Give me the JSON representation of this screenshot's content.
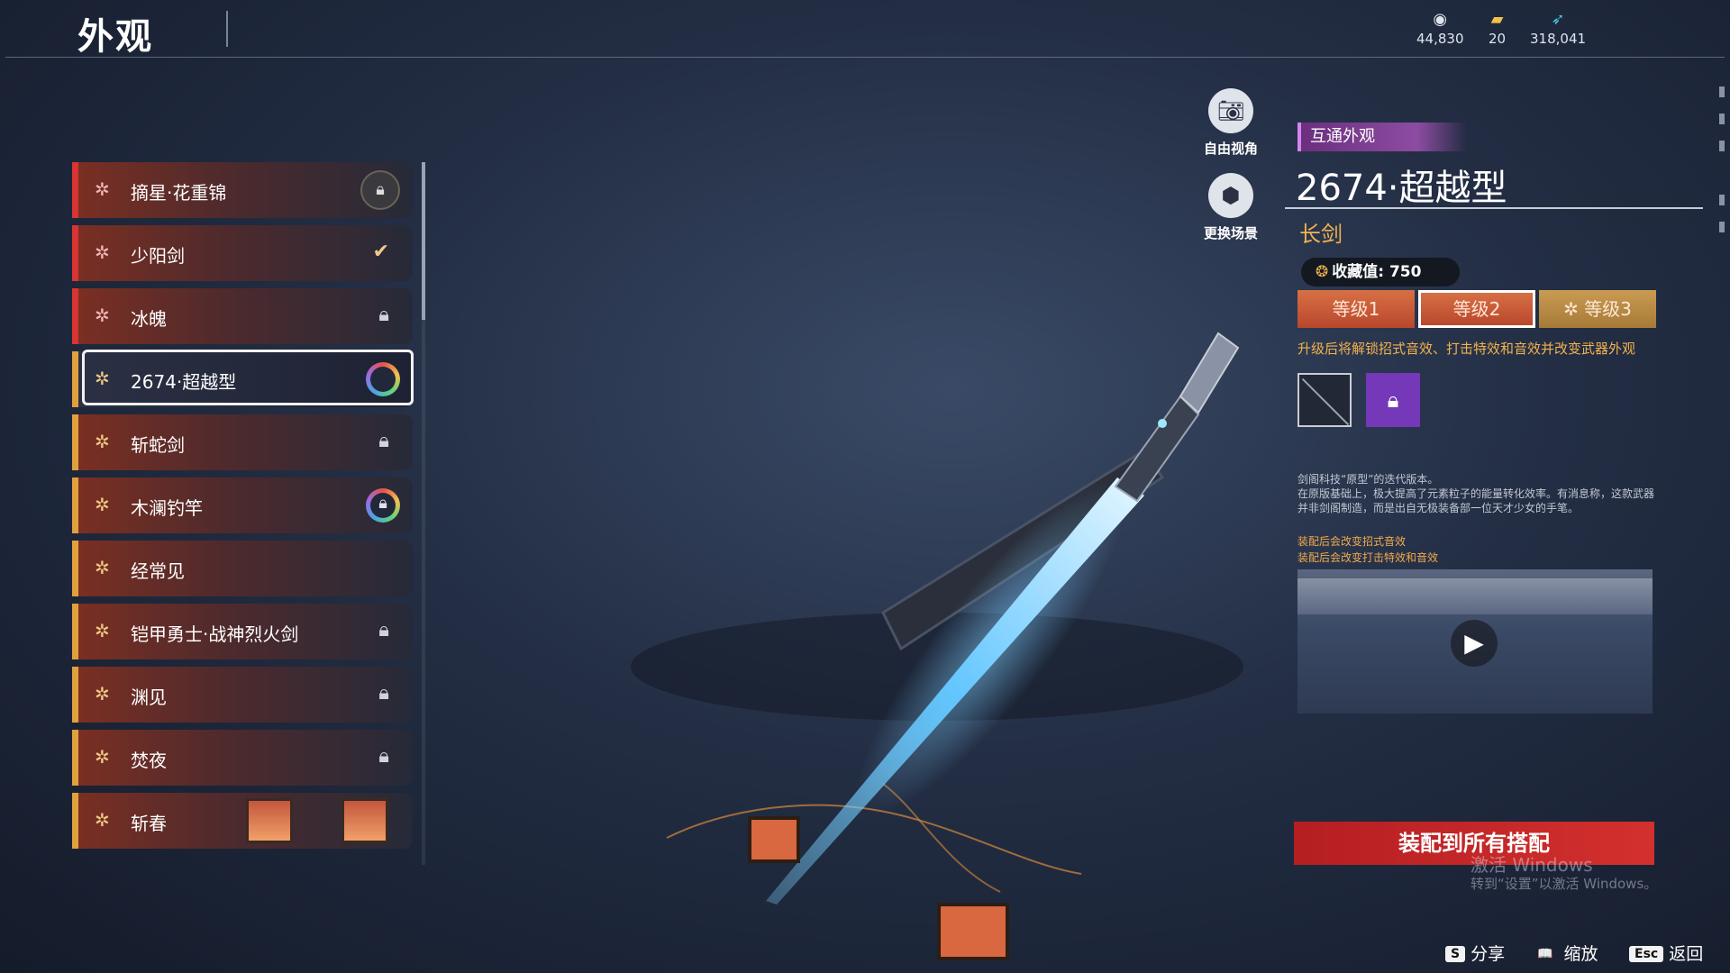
{
  "header": {
    "title": "外观",
    "currencies": [
      {
        "icon": "coin-pile-icon",
        "value": "44,830"
      },
      {
        "icon": "ticket-icon",
        "value": "20"
      },
      {
        "icon": "feather-icon",
        "value": "318,041"
      }
    ]
  },
  "weapon_list": {
    "items": [
      {
        "label": "摘星·花重锦",
        "rarity": "red",
        "state": "locked"
      },
      {
        "label": "少阳剑",
        "rarity": "red",
        "state": "equipped"
      },
      {
        "label": "冰魄",
        "rarity": "red",
        "state": "locked"
      },
      {
        "label": "2674·超越型",
        "rarity": "gold",
        "state": "selected"
      },
      {
        "label": "斩蛇剑",
        "rarity": "gold",
        "state": "locked"
      },
      {
        "label": "木澜钓竿",
        "rarity": "gold",
        "state": "locked"
      },
      {
        "label": "经常见",
        "rarity": "gold",
        "state": "owned"
      },
      {
        "label": "铠甲勇士·战神烈火剑",
        "rarity": "gold",
        "state": "locked"
      },
      {
        "label": "渊见",
        "rarity": "gold",
        "state": "locked"
      },
      {
        "label": "焚夜",
        "rarity": "gold",
        "state": "locked"
      },
      {
        "label": "斩春",
        "rarity": "gold",
        "state": "locked"
      }
    ]
  },
  "camera": {
    "free_view": "自由视角",
    "change_scene": "更换场景"
  },
  "detail": {
    "tag": "互通外观",
    "name": "2674·超越型",
    "type": "长剑",
    "collection": "收藏值: 750",
    "tiers": [
      "等级1",
      "等级2",
      "等级3"
    ],
    "active_tier": "等级2",
    "tier_hint": "升级后将解锁招式音效、打击特效和音效并改变武器外观",
    "description": "剑阁科技“原型”的迭代版本。\n在原版基础上，极大提高了元素粒子的能量转化效率。有消息称，这款武器并非剑阁制造，而是出自无极装备部一位天才少女的手笔。",
    "effect_1": "装配后会改变招式音效",
    "effect_2": "装配后会改变打击特效和音效",
    "equip_button": "装配到所有搭配"
  },
  "watermark": {
    "line1": "激活 Windows",
    "line2": "转到“设置”以激活 Windows。"
  },
  "hotkeys": [
    {
      "key": "S",
      "label": "分享"
    },
    {
      "key": "📖",
      "label": "缩放"
    },
    {
      "key": "Esc",
      "label": "返回"
    }
  ]
}
